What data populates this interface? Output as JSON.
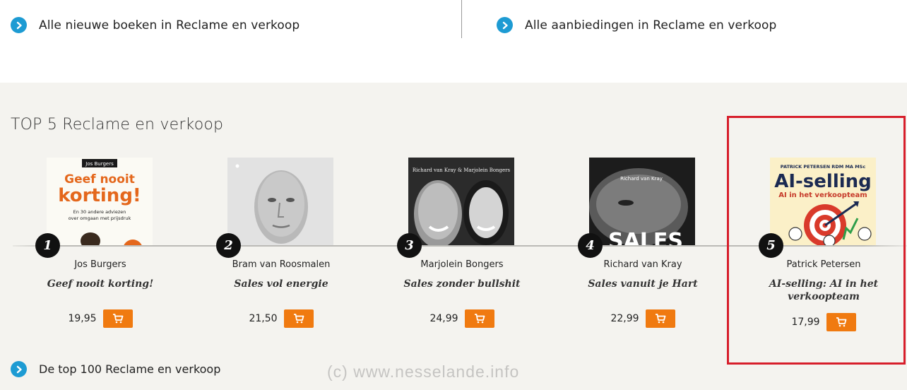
{
  "top_links": {
    "new_books": "Alle nieuwe boeken in Reclame en verkoop",
    "offers": "Alle aanbiedingen in Reclame en verkoop"
  },
  "section": {
    "title": "TOP 5 Reclame en verkoop"
  },
  "books": [
    {
      "rank": "1",
      "author": "Jos Burgers",
      "title": "Geef nooit korting!",
      "price": "19,95",
      "cover": {
        "author_tag": "Jos Burgers",
        "title_line1": "Geef nooit",
        "title_line2": "korting!",
        "subtitle_line1": "En 30 andere adviezen",
        "subtitle_line2": "over omgaan met prijsdruk"
      }
    },
    {
      "rank": "2",
      "author": "Bram van Roosmalen",
      "title": "Sales vol energie",
      "price": "21,50"
    },
    {
      "rank": "3",
      "author": "Marjolein Bongers",
      "title": "Sales zonder bullshit",
      "price": "24,99",
      "cover": {
        "authors_line": "Richard van Kray & Marjolein Bongers"
      }
    },
    {
      "rank": "4",
      "author": "Richard van Kray",
      "title": "Sales vanuit je Hart",
      "price": "22,99",
      "cover": {
        "author_line": "Richard van Kray",
        "big_text": "SALES"
      }
    },
    {
      "rank": "5",
      "author": "Patrick Petersen",
      "title": "AI-selling: AI in het verkoopteam",
      "price": "17,99",
      "cover": {
        "author_line": "PATRICK PETERSEN RDM MA MSc",
        "title_line": "AI-selling",
        "subtitle_line": "AI in het verkoopteam"
      }
    }
  ],
  "bottom_link": "De top 100 Reclame en verkoop",
  "watermark": "(c)  www.nesselande.info",
  "colors": {
    "accent_blue": "#1d9bd3",
    "cart_orange": "#f07a10",
    "highlight_red": "#d71e2b",
    "section_bg": "#f4f3ef"
  },
  "icons": {
    "link_icon": "chevron-right-circle-icon",
    "cart_icon": "shopping-cart-icon"
  }
}
